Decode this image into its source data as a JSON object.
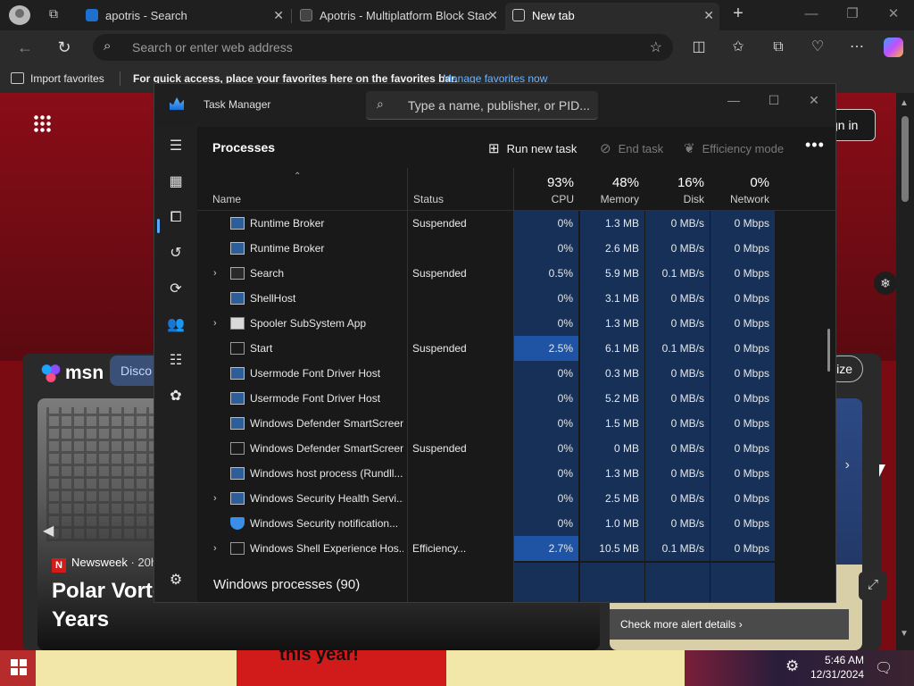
{
  "browser": {
    "tabs": [
      {
        "title": "apotris - Search",
        "close": "✕"
      },
      {
        "title": "Apotris - Multiplatform Block Stac",
        "close": "✕"
      },
      {
        "title": "New tab",
        "close": "✕"
      }
    ],
    "new_tab_label": "+",
    "window_controls": {
      "minimize": "—",
      "restore": "❐",
      "close": "✕"
    },
    "address_placeholder": "Search or enter web address",
    "favorites_bar": {
      "import": "Import favorites",
      "message": "For quick access, place your favorites here on the favorites bar.",
      "link": "Manage favorites now"
    }
  },
  "page": {
    "signin": "gn in",
    "msn_logo": "msn",
    "discover_tab": "Disco",
    "personalize": "lize",
    "card": {
      "source": "Newsweek",
      "source_badge": "N",
      "time": "· 20h",
      "headline_line1": "Polar Vorte",
      "headline_line2": "Years"
    },
    "alert_link": "Check more alert details ›"
  },
  "taskbar": {
    "cartoon_text": "this year!",
    "time": "5:46 AM",
    "date": "12/31/2024"
  },
  "task_manager": {
    "title": "Task Manager",
    "search_placeholder": "Type a name, publisher, or PID...",
    "window_controls": {
      "minimize": "—",
      "maximize": "☐",
      "close": "✕"
    },
    "heading": "Processes",
    "toolbar": {
      "run_new_task": "Run new task",
      "end_task": "End task",
      "efficiency_mode": "Efficiency mode",
      "more": "•••"
    },
    "columns": {
      "name": "Name",
      "status": "Status",
      "cpu": {
        "percent": "93%",
        "label": "CPU"
      },
      "memory": {
        "percent": "48%",
        "label": "Memory"
      },
      "disk": {
        "percent": "16%",
        "label": "Disk"
      },
      "network": {
        "percent": "0%",
        "label": "Network"
      }
    },
    "rows": [
      {
        "expand": "",
        "icon": "app",
        "name": "Runtime Broker",
        "status": "Suspended",
        "cpu": "0%",
        "memory": "1.3 MB",
        "disk": "0 MB/s",
        "network": "0 Mbps"
      },
      {
        "expand": "",
        "icon": "app",
        "name": "Runtime Broker",
        "status": "",
        "cpu": "0%",
        "memory": "2.6 MB",
        "disk": "0 MB/s",
        "network": "0 Mbps"
      },
      {
        "expand": "›",
        "icon": "search",
        "name": "Search",
        "status": "Suspended",
        "cpu": "0.5%",
        "memory": "5.9 MB",
        "disk": "0.1 MB/s",
        "network": "0 Mbps"
      },
      {
        "expand": "",
        "icon": "app",
        "name": "ShellHost",
        "status": "",
        "cpu": "0%",
        "memory": "3.1 MB",
        "disk": "0 MB/s",
        "network": "0 Mbps"
      },
      {
        "expand": "›",
        "icon": "print",
        "name": "Spooler SubSystem App",
        "status": "",
        "cpu": "0%",
        "memory": "1.3 MB",
        "disk": "0 MB/s",
        "network": "0 Mbps"
      },
      {
        "expand": "",
        "icon": "susp",
        "name": "Start",
        "status": "Suspended",
        "cpu": "2.5%",
        "memory": "6.1 MB",
        "disk": "0.1 MB/s",
        "network": "0 Mbps",
        "cpu_high": true
      },
      {
        "expand": "",
        "icon": "app",
        "name": "Usermode Font Driver Host",
        "status": "",
        "cpu": "0%",
        "memory": "0.3 MB",
        "disk": "0 MB/s",
        "network": "0 Mbps"
      },
      {
        "expand": "",
        "icon": "app",
        "name": "Usermode Font Driver Host",
        "status": "",
        "cpu": "0%",
        "memory": "5.2 MB",
        "disk": "0 MB/s",
        "network": "0 Mbps"
      },
      {
        "expand": "",
        "icon": "app",
        "name": "Windows Defender SmartScreen",
        "status": "",
        "cpu": "0%",
        "memory": "1.5 MB",
        "disk": "0 MB/s",
        "network": "0 Mbps"
      },
      {
        "expand": "",
        "icon": "susp",
        "name": "Windows Defender SmartScreen",
        "status": "Suspended",
        "cpu": "0%",
        "memory": "0 MB",
        "disk": "0 MB/s",
        "network": "0 Mbps"
      },
      {
        "expand": "",
        "icon": "app",
        "name": "Windows host process (Rundll...",
        "status": "",
        "cpu": "0%",
        "memory": "1.3 MB",
        "disk": "0 MB/s",
        "network": "0 Mbps"
      },
      {
        "expand": "›",
        "icon": "app",
        "name": "Windows Security Health Servi...",
        "status": "",
        "cpu": "0%",
        "memory": "2.5 MB",
        "disk": "0 MB/s",
        "network": "0 Mbps"
      },
      {
        "expand": "",
        "icon": "shield",
        "name": "Windows Security notification...",
        "status": "",
        "cpu": "0%",
        "memory": "1.0 MB",
        "disk": "0 MB/s",
        "network": "0 Mbps"
      },
      {
        "expand": "›",
        "icon": "susp",
        "name": "Windows Shell Experience Hos...",
        "status": "Efficiency...",
        "cpu": "2.7%",
        "memory": "10.5 MB",
        "disk": "0.1 MB/s",
        "network": "0 Mbps",
        "cpu_high": true
      }
    ],
    "group_label": "Windows processes (90)",
    "nav_icons": [
      "menu-icon",
      "processes-icon",
      "performance-icon",
      "app-history-icon",
      "startup-apps-icon",
      "users-icon",
      "details-icon",
      "services-icon",
      "settings-icon"
    ]
  }
}
